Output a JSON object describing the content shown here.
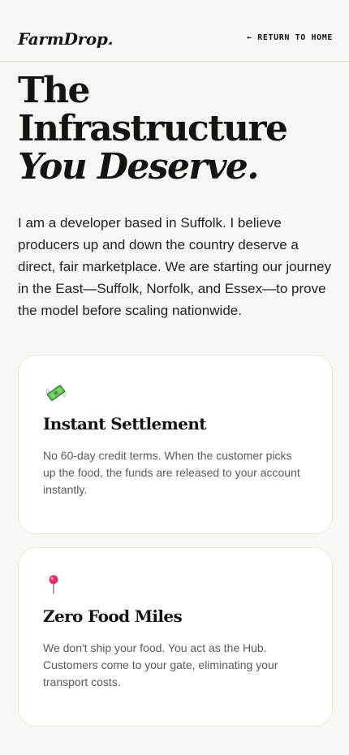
{
  "header": {
    "logo": "FarmDrop.",
    "return_link": "← RETURN TO HOME"
  },
  "hero": {
    "title_line1": "The",
    "title_line2": "Infrastructure",
    "title_line3": "You Deserve."
  },
  "intro": {
    "text": "I am a developer based in Suffolk. I believe producers up and down the country deserve a direct, fair marketplace. We are starting our journey in the East—Suffolk, Norfolk, and Essex—to prove the model before scaling nationwide."
  },
  "features": [
    {
      "icon": "money-with-wings-icon",
      "title": "Instant Settlement",
      "text": "No 60-day credit terms. When the customer picks up the food, the funds are released to your account instantly."
    },
    {
      "icon": "pushpin-icon",
      "title": "Zero Food Miles",
      "text": "We don't ship your food. You act as the Hub. Customers come to your gate, eliminating your transport costs."
    }
  ],
  "colors": {
    "background": "#f9f7f3",
    "text": "#141414",
    "card": "#ffffff",
    "muted": "#5a5a5a",
    "money_green": "#3f9b3a",
    "pin_pink": "#e0306a"
  }
}
